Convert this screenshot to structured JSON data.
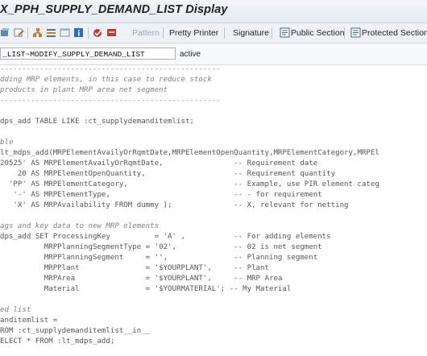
{
  "title": "X_PPH_SUPPLY_DEMAND_LIST Display",
  "toolbar": {
    "pattern_label": "Pattern",
    "pretty_printer_label": "Pretty Printer",
    "signature_label": "Signature",
    "public_section_label": "Public Section",
    "protected_section_label": "Protected Section"
  },
  "object": {
    "name": "_LIST~MODIFY_SUPPLY_DEMAND_LIST",
    "status": "active"
  },
  "code_lines": [
    "--------------------------------------------------",
    "dding MRP elements, in this case to reduce stock",
    "products in plant MRP area net segment",
    "--------------------------------------------------",
    "",
    "dps_add TABLE LIKE :ct_supplydemanditemlist;",
    "",
    "ble",
    "lt_mdps_add(MRPElementAvailyOrRqmtDate,MRPElementOpenQuantity,MRPElementCategory,MRPEl",
    "20525' AS MRPElementAvailyOrRqmtDate,                -- Requirement date",
    "    20 AS MRPElementOpenQuantity,                    -- Requirement quantity",
    "  'PP' AS MRPElementCategory,                        -- Example, use PIR element categ",
    "   '-' AS MRPElementType,                            -- - for requirement",
    "   'X' AS MRPAvailability FROM dummy );              -- X, relevant for netting",
    "",
    "ags and key data to new MRP elements",
    "dps_add SET ProcessingKey          = 'A' ,           -- For adding elements",
    "          MRPPlanningSegmentType = '02',             -- 02 is net segment",
    "          MRPPlanningSegment     = '',               -- Planning segment",
    "          MRPPlant               = '$YOURPLANT',     -- Plant",
    "          MRPArea                = '$YOURPLANT',     -- MRP Area",
    "          Material               = '$YOURMATERIAL'; -- My Material",
    "",
    "ed list",
    "anditemlist =",
    "ROM :ct_supplydemanditemlist__in__",
    "ELECT * FROM :lt_mdps_add;"
  ]
}
